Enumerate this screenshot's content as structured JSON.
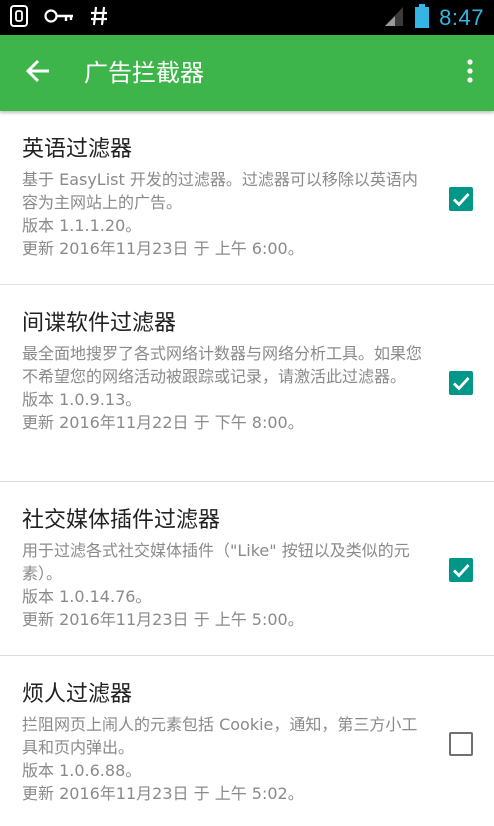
{
  "status_bar": {
    "time": "8:47",
    "icons": [
      "notification-icon",
      "key-icon",
      "hash-icon",
      "signal-icon",
      "battery-icon"
    ]
  },
  "app_bar": {
    "title": "广告拦截器",
    "background": "#3db54a"
  },
  "filters": [
    {
      "title": "英语过滤器",
      "description": "基于 EasyList 开发的过滤器。过滤器可以移除以英语内容为主网站上的广告。",
      "version": "版本 1.1.1.20。",
      "updated": "更新 2016年11月23日 于 上午 6:00。",
      "checked": true
    },
    {
      "title": "间谍软件过滤器",
      "description": "最全面地搜罗了各式网络计数器与网络分析工具。如果您不希望您的网络活动被跟踪或记录，请激活此过滤器。",
      "version": "版本 1.0.9.13。",
      "updated": "更新 2016年11月22日 于 下午 8:00。",
      "checked": true
    },
    {
      "title": "社交媒体插件过滤器",
      "description": "用于过滤各式社交媒体插件（\"Like\" 按钮以及类似的元素）。",
      "version": "版本 1.0.14.76。",
      "updated": "更新 2016年11月23日 于 上午 5:00。",
      "checked": true
    },
    {
      "title": "烦人过滤器",
      "description": "拦阻网页上闹人的元素包括 Cookie，通知，第三方小工具和页内弹出。",
      "version": "版本 1.0.6.88。",
      "updated": "更新 2016年11月23日 于 上午 5:02。",
      "checked": false
    }
  ],
  "colors": {
    "accent": "#009688",
    "clock": "#33b5e5"
  }
}
